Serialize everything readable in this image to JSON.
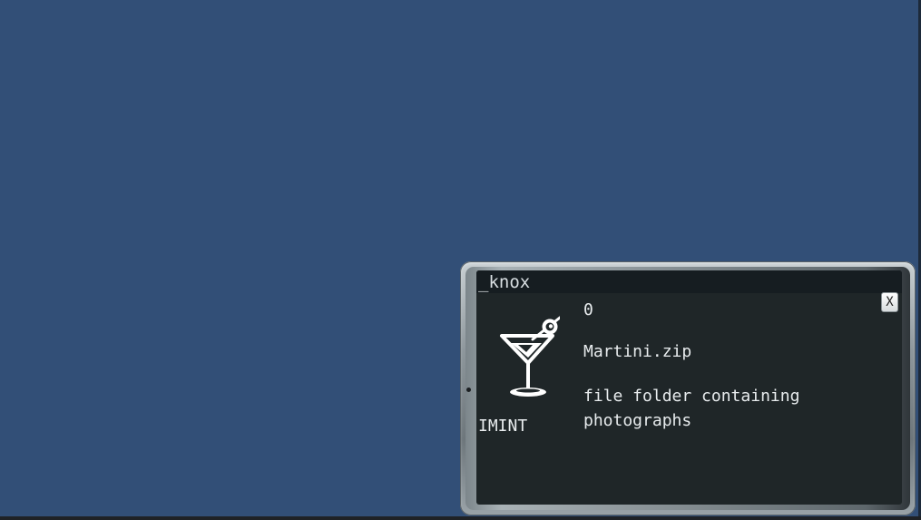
{
  "window": {
    "title": "_knox",
    "close_label": "X"
  },
  "item": {
    "count": "0",
    "filename": "Martini.zip",
    "description": "file folder containing photographs",
    "category": "IMINT",
    "icon": "martini-glass-icon"
  },
  "colors": {
    "desktop": "#324f77",
    "screen": "#1f2628",
    "titlebar": "#161d21",
    "text": "#e8ecee"
  }
}
